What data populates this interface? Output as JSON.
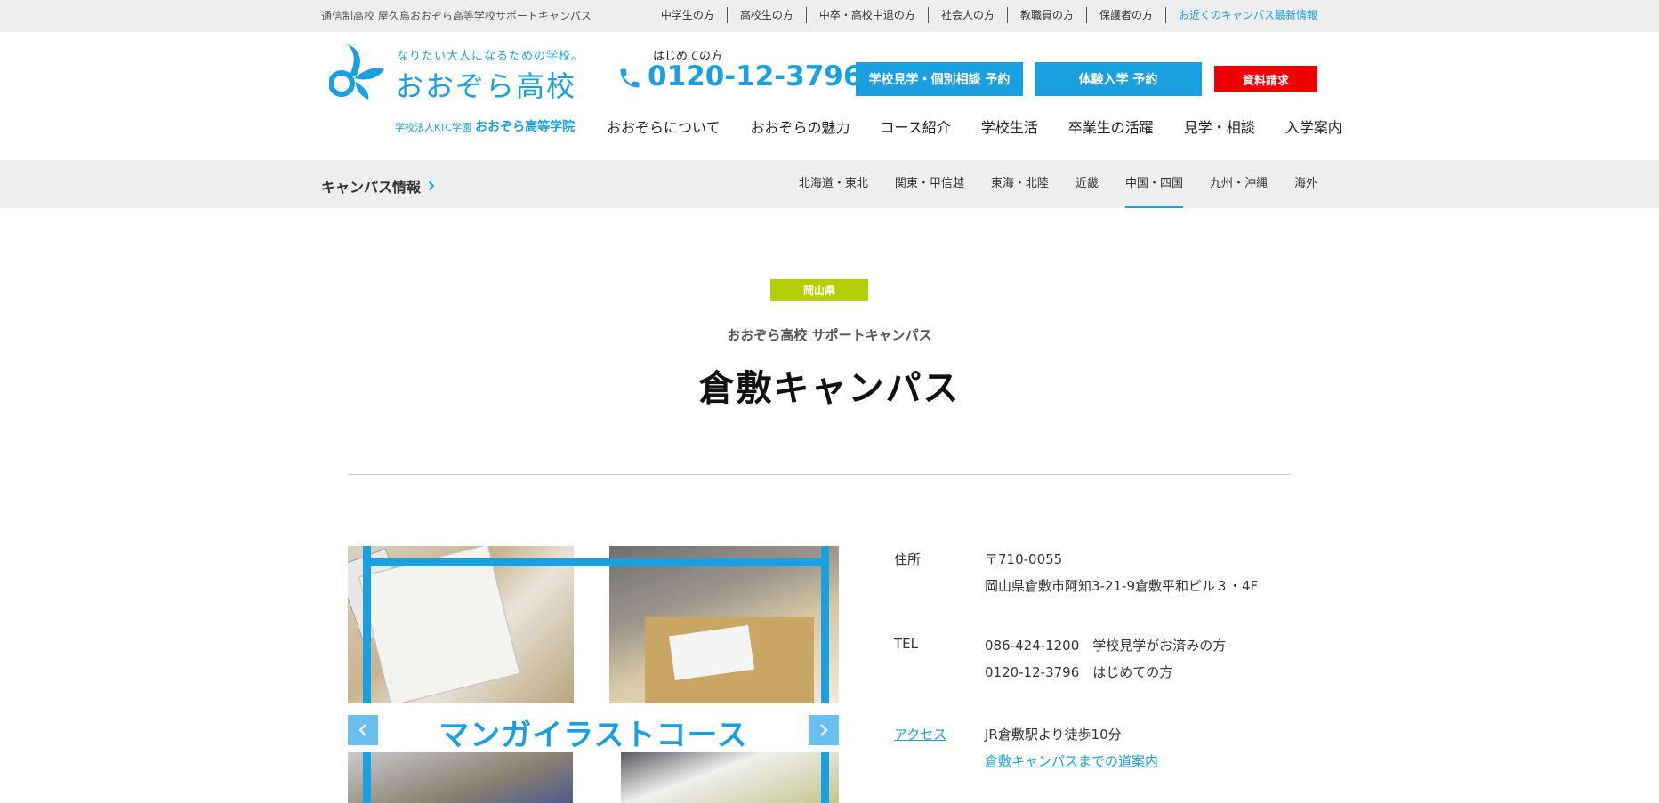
{
  "topbar": {
    "site_desc": "通信制高校 屋久島おおぞら高等学校サポートキャンパス",
    "links": [
      "中学生の方",
      "高校生の方",
      "中卒・高校中退の方",
      "社会人の方",
      "教職員の方",
      "保護者の方",
      "お近くのキャンパス最新情報"
    ]
  },
  "logo": {
    "tagline": "なりたい大人になるための学校。",
    "name": "おおぞら高校",
    "corp": "学校法人KTC学園",
    "corp_school": "おおぞら高等学院"
  },
  "phone": {
    "caption": "はじめての方",
    "number": "0120-12-3796"
  },
  "buttons": {
    "visit": "学校見学・個別相談 予約",
    "trial": "体験入学 予約",
    "docs": "資料請求"
  },
  "global_nav": [
    "おおぞらについて",
    "おおぞらの魅力",
    "コース紹介",
    "学校生活",
    "卒業生の活躍",
    "見学・相談",
    "入学案内"
  ],
  "band": {
    "campus_info": "キャンパス情報",
    "regions": [
      "北海道・東北",
      "関東・甲信越",
      "東海・北陸",
      "近畿",
      "中国・四国",
      "九州・沖縄",
      "海外"
    ],
    "active_region": "中国・四国"
  },
  "campus": {
    "prefecture": "岡山県",
    "school_sub": "おおぞら高校 サポートキャンパス",
    "title": "倉敷キャンパス"
  },
  "slider": {
    "banner": "マンガイラストコース"
  },
  "info": {
    "address_label": "住所",
    "postal": "〒710-0055",
    "address": "岡山県倉敷市阿知3-21-9倉敷平和ビル３・4F",
    "tel_label": "TEL",
    "tel1": "086-424-1200　学校見学がお済みの方",
    "tel2": "0120-12-3796　はじめての方",
    "access_label": "アクセス",
    "access": "JR倉敷駅より徒歩10分",
    "access_link": "倉敷キャンパスまでの道案内"
  },
  "colors": {
    "brand_blue": "#1a9fdf",
    "docs_red": "#ef0000",
    "prefecture_green": "#b3cf0a",
    "band_gray": "#eeeeee"
  }
}
